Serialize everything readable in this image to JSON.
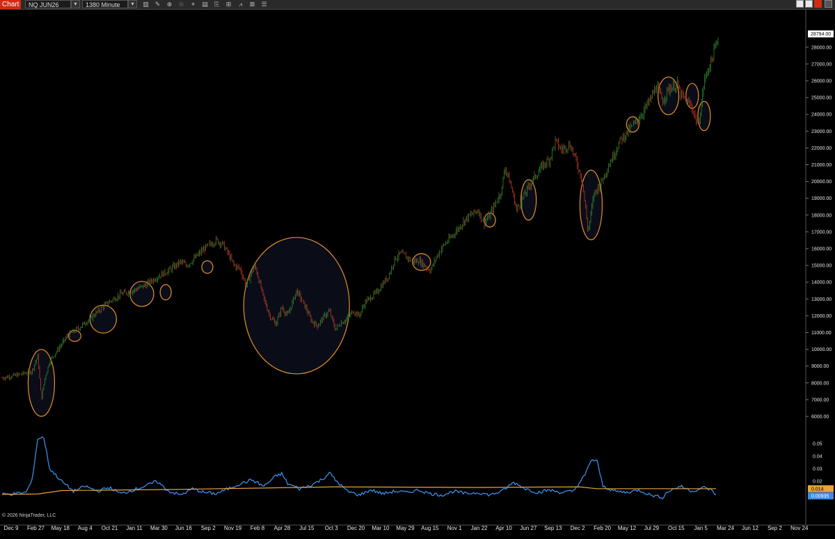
{
  "toolbar": {
    "title": "Chart",
    "instrument": "NQ JUN26",
    "interval": "1380 Minute"
  },
  "copyright": "© 2026 NinjaTrader, LLC",
  "colors": {
    "up": "#2e8b2e",
    "down": "#c0392b",
    "highlight": "#e8902a",
    "indicator_line": "#3b8ee8",
    "indicator_avg": "#e8a23a"
  },
  "chart_data": {
    "type": "candlestick",
    "price_axis_labels": [
      "28000.00",
      "27000.00",
      "26000.00",
      "25000.00",
      "24000.00",
      "23000.00",
      "22000.00",
      "21000.00",
      "20000.00",
      "19000.00",
      "18000.00",
      "17000.00",
      "16000.00",
      "15000.00",
      "14000.00",
      "13000.00",
      "12000.00",
      "11000.00",
      "10000.00",
      "9000.00",
      "8000.00",
      "7000.00",
      "6000.00"
    ],
    "price_range": [
      5500,
      29500
    ],
    "last_price": "28794.00",
    "date_labels": [
      "Dec 9",
      "Feb 27",
      "May 18",
      "Aug 4",
      "Oct 21",
      "Jan 11",
      "Mar 30",
      "Jun 16",
      "Sep 2",
      "Nov 19",
      "Feb 8",
      "Apr 28",
      "Jul 15",
      "Oct 3",
      "Dec 20",
      "Mar 10",
      "May 29",
      "Aug 15",
      "Nov 1",
      "Jan 22",
      "Apr 10",
      "Jun 27",
      "Sep 13",
      "Dec 2",
      "Feb 20",
      "May 12",
      "Jul 29",
      "Oct 15",
      "Jan 5",
      "Mar 24",
      "Jun 12",
      "Sep 2",
      "Nov 24"
    ],
    "price_path": [
      [
        0,
        8300
      ],
      [
        3,
        8500
      ],
      [
        5,
        8700
      ],
      [
        6,
        9600
      ],
      [
        6.6,
        7000
      ],
      [
        7.2,
        8300
      ],
      [
        8,
        9300
      ],
      [
        11,
        10800
      ],
      [
        13,
        11300
      ],
      [
        15,
        11900
      ],
      [
        17.5,
        12700
      ],
      [
        20,
        13300
      ],
      [
        22,
        13500
      ],
      [
        24,
        13800
      ],
      [
        26,
        14300
      ],
      [
        28,
        14700
      ],
      [
        30,
        15200
      ],
      [
        31,
        15000
      ],
      [
        32,
        15300
      ],
      [
        34,
        16000
      ],
      [
        36,
        16500
      ],
      [
        37,
        16300
      ],
      [
        38,
        15700
      ],
      [
        39,
        15000
      ],
      [
        40,
        14800
      ],
      [
        41,
        13800
      ],
      [
        42.5,
        15000
      ],
      [
        44,
        13000
      ],
      [
        45,
        12000
      ],
      [
        46,
        11500
      ],
      [
        47,
        12500
      ],
      [
        48,
        12000
      ],
      [
        49.5,
        13500
      ],
      [
        51,
        12500
      ],
      [
        52,
        11700
      ],
      [
        53,
        11400
      ],
      [
        54,
        11900
      ],
      [
        55,
        12300
      ],
      [
        56,
        11200
      ],
      [
        57,
        11600
      ],
      [
        58,
        11800
      ],
      [
        59,
        12300
      ],
      [
        60,
        12000
      ],
      [
        61,
        12800
      ],
      [
        63,
        13400
      ],
      [
        65,
        14400
      ],
      [
        66,
        15400
      ],
      [
        67,
        15700
      ],
      [
        68,
        15500
      ],
      [
        69,
        15200
      ],
      [
        70,
        15300
      ],
      [
        71,
        15000
      ],
      [
        72,
        14700
      ],
      [
        73,
        15500
      ],
      [
        74,
        16100
      ],
      [
        76,
        16900
      ],
      [
        78,
        17800
      ],
      [
        80,
        18300
      ],
      [
        81,
        17500
      ],
      [
        82,
        18000
      ],
      [
        84,
        19500
      ],
      [
        84.5,
        20900
      ],
      [
        85.5,
        19800
      ],
      [
        86.5,
        18300
      ],
      [
        87.5,
        19000
      ],
      [
        89,
        20000
      ],
      [
        91,
        21000
      ],
      [
        92,
        21300
      ],
      [
        93,
        22400
      ],
      [
        94,
        21900
      ],
      [
        95.5,
        22200
      ],
      [
        96.5,
        21200
      ],
      [
        97.5,
        20100
      ],
      [
        98.5,
        17000
      ],
      [
        99.5,
        19300
      ],
      [
        100.5,
        19800
      ],
      [
        102,
        21000
      ],
      [
        104,
        22500
      ],
      [
        106,
        23300
      ],
      [
        107.5,
        24000
      ],
      [
        109,
        24900
      ],
      [
        110,
        25700
      ],
      [
        111,
        24800
      ],
      [
        112,
        25500
      ],
      [
        113.5,
        25800
      ],
      [
        114,
        25200
      ],
      [
        115,
        24800
      ],
      [
        116,
        24400
      ],
      [
        117,
        23300
      ],
      [
        117.5,
        24500
      ],
      [
        118,
        26000
      ],
      [
        119.5,
        27500
      ],
      [
        120.5,
        28794
      ]
    ],
    "highlighted_zones": [
      {
        "idx": 6.6,
        "price": 8000,
        "rx": 19,
        "ry": 48
      },
      {
        "idx": 12.2,
        "price": 10800,
        "rx": 9,
        "ry": 8
      },
      {
        "idx": 17,
        "price": 11800,
        "rx": 19,
        "ry": 20
      },
      {
        "idx": 23.5,
        "price": 13300,
        "rx": 17,
        "ry": 18
      },
      {
        "idx": 27.5,
        "price": 13400,
        "rx": 8,
        "ry": 11
      },
      {
        "idx": 34.5,
        "price": 14900,
        "rx": 8,
        "ry": 9
      },
      {
        "idx": 49.5,
        "price": 12600,
        "rx": 76,
        "ry": 98
      },
      {
        "idx": 70.5,
        "price": 15200,
        "rx": 13,
        "ry": 12
      },
      {
        "idx": 82,
        "price": 17700,
        "rx": 8,
        "ry": 10
      },
      {
        "idx": 88.5,
        "price": 18900,
        "rx": 11,
        "ry": 29
      },
      {
        "idx": 99,
        "price": 18600,
        "rx": 16,
        "ry": 50
      },
      {
        "idx": 106,
        "price": 23400,
        "rx": 9,
        "ry": 11
      },
      {
        "idx": 112,
        "price": 25100,
        "rx": 15,
        "ry": 27
      },
      {
        "idx": 116,
        "price": 25100,
        "rx": 9,
        "ry": 18
      },
      {
        "idx": 118,
        "price": 23900,
        "rx": 9,
        "ry": 21
      }
    ],
    "indicator": {
      "axis_labels": [
        "0.05",
        "0.04",
        "0.03",
        "0.02"
      ],
      "range": [
        0.0,
        0.058
      ],
      "value_label": "0.00935",
      "average_label": "0.014",
      "average_series": [
        [
          0,
          0.0095
        ],
        [
          6,
          0.0098
        ],
        [
          10,
          0.0125
        ],
        [
          30,
          0.0135
        ],
        [
          56,
          0.0155
        ],
        [
          80,
          0.015
        ],
        [
          97,
          0.0155
        ],
        [
          100,
          0.014
        ],
        [
          120,
          0.014
        ]
      ],
      "value_series": [
        [
          0,
          0.0095
        ],
        [
          2,
          0.01
        ],
        [
          4,
          0.011
        ],
        [
          5,
          0.02
        ],
        [
          6,
          0.054
        ],
        [
          7,
          0.055
        ],
        [
          8,
          0.03
        ],
        [
          10,
          0.02
        ],
        [
          12,
          0.012
        ],
        [
          14,
          0.016
        ],
        [
          16,
          0.012
        ],
        [
          18,
          0.015
        ],
        [
          20,
          0.01
        ],
        [
          22,
          0.013
        ],
        [
          24,
          0.016
        ],
        [
          26,
          0.02
        ],
        [
          28,
          0.012
        ],
        [
          30,
          0.009
        ],
        [
          32,
          0.014
        ],
        [
          34,
          0.011
        ],
        [
          36,
          0.01
        ],
        [
          38,
          0.014
        ],
        [
          40,
          0.018
        ],
        [
          42,
          0.021
        ],
        [
          44,
          0.016
        ],
        [
          46,
          0.024
        ],
        [
          47,
          0.026
        ],
        [
          48,
          0.018
        ],
        [
          50,
          0.014
        ],
        [
          52,
          0.017
        ],
        [
          54,
          0.022
        ],
        [
          55,
          0.027
        ],
        [
          56,
          0.021
        ],
        [
          58,
          0.012
        ],
        [
          60,
          0.009
        ],
        [
          62,
          0.013
        ],
        [
          64,
          0.01
        ],
        [
          66,
          0.012
        ],
        [
          68,
          0.011
        ],
        [
          70,
          0.013
        ],
        [
          72,
          0.01
        ],
        [
          74,
          0.009
        ],
        [
          76,
          0.012
        ],
        [
          78,
          0.01
        ],
        [
          80,
          0.011
        ],
        [
          82,
          0.009
        ],
        [
          84,
          0.012
        ],
        [
          86,
          0.019
        ],
        [
          88,
          0.014
        ],
        [
          90,
          0.011
        ],
        [
          92,
          0.013
        ],
        [
          94,
          0.011
        ],
        [
          96,
          0.012
        ],
        [
          98,
          0.025
        ],
        [
          99,
          0.037
        ],
        [
          100,
          0.036
        ],
        [
          101,
          0.016
        ],
        [
          103,
          0.012
        ],
        [
          105,
          0.011
        ],
        [
          107,
          0.013
        ],
        [
          109,
          0.009
        ],
        [
          111,
          0.007
        ],
        [
          112,
          0.012
        ],
        [
          114,
          0.016
        ],
        [
          116,
          0.012
        ],
        [
          118,
          0.015
        ],
        [
          119,
          0.0135
        ],
        [
          120,
          0.00935
        ]
      ]
    }
  }
}
